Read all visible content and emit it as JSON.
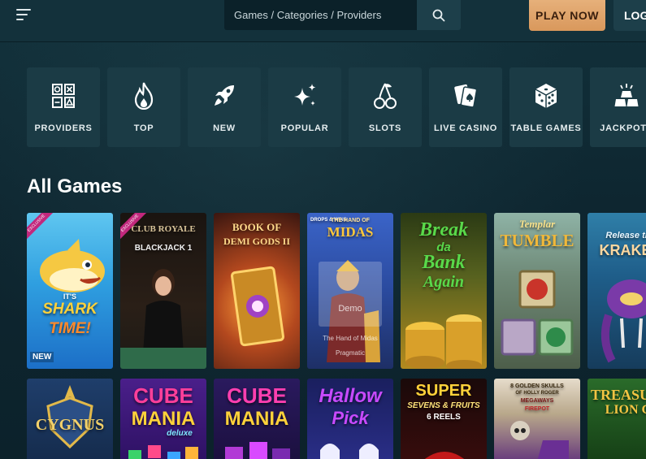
{
  "header": {
    "search_placeholder": "Games / Categories / Providers",
    "play_now_label": "PLAY NOW",
    "login_label": "LOG"
  },
  "categories": [
    {
      "label": "PROVIDERS",
      "icon": "providers-grid-icon"
    },
    {
      "label": "TOP",
      "icon": "flame-icon"
    },
    {
      "label": "NEW",
      "icon": "rocket-icon"
    },
    {
      "label": "POPULAR",
      "icon": "sparkles-icon"
    },
    {
      "label": "SLOTS",
      "icon": "cherries-icon"
    },
    {
      "label": "LIVE CASINO",
      "icon": "playing-cards-icon"
    },
    {
      "label": "TABLE GAMES",
      "icon": "dice-icon"
    },
    {
      "label": "JACKPOTS",
      "icon": "gold-bars-icon"
    }
  ],
  "section_title": "All Games",
  "games_row1": [
    {
      "title_lines": [
        "IT'S",
        "SHARK",
        "TIME!"
      ],
      "badge": "NEW",
      "ribbon": "EXCLUSIVE"
    },
    {
      "title_lines": [
        "CLUB ROYALE",
        "BLACKJACK 1"
      ],
      "ribbon": "EXCLUSIVE"
    },
    {
      "title_lines": [
        "BOOK OF",
        "DEMI GODS II"
      ]
    },
    {
      "title_lines": [
        "THE HAND OF",
        "MIDAS"
      ],
      "tag": "DROPS & WINS",
      "demo_label": "Demo",
      "demo_name": "The Hand of Midas",
      "demo_provider": "Pragmatic"
    },
    {
      "title_lines": [
        "Break",
        "da",
        "Bank",
        "Again"
      ]
    },
    {
      "title_lines": [
        "Templar",
        "TUMBLE"
      ]
    },
    {
      "title_lines": [
        "Release the",
        "KRAKEN"
      ]
    }
  ],
  "games_row2": [
    {
      "title_lines": [
        "CYGNUS"
      ]
    },
    {
      "title_lines": [
        "CUBE",
        "MANIA",
        "deluxe"
      ]
    },
    {
      "title_lines": [
        "CUBE",
        "MANIA"
      ]
    },
    {
      "title_lines": [
        "Hallow",
        "Pick"
      ]
    },
    {
      "title_lines": [
        "SUPER",
        "SEVENS & FRUITS",
        "6 REELS"
      ]
    },
    {
      "title_lines": [
        "8 GOLDEN SKULLS",
        "OF HOLLY ROGER",
        "MEGAWAYS",
        "FIREPOT"
      ]
    },
    {
      "title_lines": [
        "TREASURE",
        "LION CI"
      ]
    }
  ],
  "colors": {
    "background": "#0f2a33",
    "topbar": "#13313b",
    "tile": "#1b3b45",
    "accent": "#d9985c"
  }
}
